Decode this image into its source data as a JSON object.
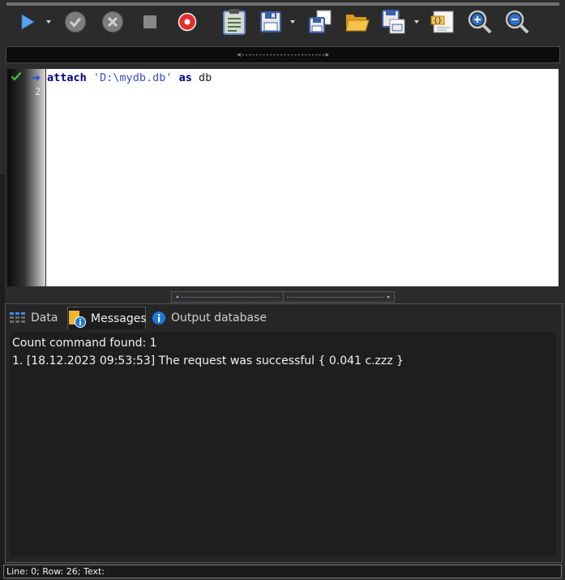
{
  "toolbar": {
    "buttons": [
      {
        "name": "run",
        "icon": "play-icon"
      },
      {
        "name": "commit",
        "icon": "check-circle-icon"
      },
      {
        "name": "rollback",
        "icon": "cancel-circle-icon"
      },
      {
        "name": "stop",
        "icon": "stop-icon"
      },
      {
        "name": "record",
        "icon": "record-icon"
      },
      {
        "name": "notes",
        "icon": "clipboard-icon"
      },
      {
        "name": "save",
        "icon": "floppy-icon"
      },
      {
        "name": "save-copy",
        "icon": "copy-floppy-icon"
      },
      {
        "name": "open",
        "icon": "folder-open-icon"
      },
      {
        "name": "save-all",
        "icon": "multi-floppy-icon"
      },
      {
        "name": "format-code",
        "icon": "code-braces-icon"
      },
      {
        "name": "zoom-in",
        "icon": "zoom-in-icon"
      },
      {
        "name": "zoom-out",
        "icon": "zoom-out-icon"
      }
    ]
  },
  "splitter": {
    "label": "<------------------------>"
  },
  "editor": {
    "lines": [
      {
        "number": "1",
        "keyword1": "attach",
        "string": "'D:\\mydb.db'",
        "keyword2": "as",
        "identifier": "db"
      },
      {
        "number": "2"
      }
    ]
  },
  "tabs": [
    {
      "label": "Data",
      "icon": "grid-icon"
    },
    {
      "label": "Messages",
      "icon": "messages-info-icon",
      "active": true
    },
    {
      "label": "Output database",
      "icon": "info-icon"
    }
  ],
  "messages": [
    "Count command found: 1",
    "1. [18.12.2023 09:53:53] The request was successful { 0.041 c.zzz }"
  ],
  "status": {
    "text": "Line: 0; Row: 26; Text:"
  },
  "colors": {
    "background": "#2b2b2b",
    "editor_bg": "#ffffff",
    "keyword": "#000080",
    "string": "#3b4fcf",
    "accent_blue": "#1f78d6",
    "record_red": "#e03030"
  }
}
